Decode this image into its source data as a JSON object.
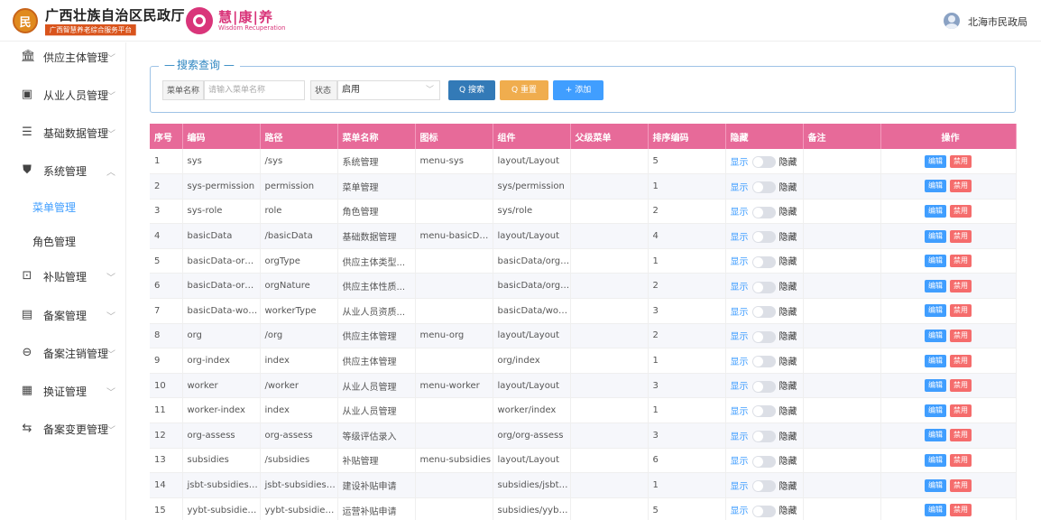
{
  "header": {
    "logo_char": "㎡",
    "org_title": "广西壮族自治区民政厅",
    "org_subtitle": "广西智慧养老综合服务平台",
    "brand_title": "慧|康|养",
    "brand_subtitle": "Wisdom Recuperation",
    "user_name": "北海市民政局"
  },
  "sidebar": {
    "items": [
      {
        "icon": "bank-icon",
        "label": "供应主体管理",
        "chevron": "﹀"
      },
      {
        "icon": "id-card-icon",
        "label": "从业人员管理",
        "chevron": "﹀"
      },
      {
        "icon": "list-icon",
        "label": "基础数据管理",
        "chevron": "﹀"
      },
      {
        "icon": "shield-icon",
        "label": "系统管理",
        "chevron": "︿"
      },
      {
        "icon": "",
        "label": "菜单管理",
        "chevron": ""
      },
      {
        "icon": "",
        "label": "角色管理",
        "chevron": ""
      },
      {
        "icon": "subsidy-icon",
        "label": "补贴管理",
        "chevron": "﹀"
      },
      {
        "icon": "file-icon",
        "label": "备案管理",
        "chevron": "﹀"
      },
      {
        "icon": "cancel-circle-icon",
        "label": "备案注销管理",
        "chevron": "﹀"
      },
      {
        "icon": "card-icon",
        "label": "换证管理",
        "chevron": "﹀"
      },
      {
        "icon": "change-icon",
        "label": "备案变更管理",
        "chevron": "﹀"
      }
    ]
  },
  "search": {
    "legend": "搜索查询",
    "menu_name_label": "菜单名称",
    "menu_name_placeholder": "请输入菜单名称",
    "status_label": "状态",
    "status_value": "启用",
    "search_button": "Q 搜索",
    "reset_button": "Q 重置",
    "add_button": "+ 添加"
  },
  "table": {
    "headers": [
      "序号",
      "编码",
      "路径",
      "菜单名称",
      "图标",
      "组件",
      "父级菜单",
      "排序编码",
      "隐藏",
      "备注",
      "操作"
    ],
    "show_text": "显示",
    "hide_text": "隐藏",
    "edit_text": "编辑",
    "disable_text": "禁用",
    "rows": [
      {
        "no": "1",
        "code": "sys",
        "path": "/sys",
        "name": "系统管理",
        "icon": "menu-sys",
        "component": "layout/Layout",
        "parent": "",
        "sort": "5",
        "remark": ""
      },
      {
        "no": "2",
        "code": "sys-permission",
        "path": "permission",
        "name": "菜单管理",
        "icon": "",
        "component": "sys/permission",
        "parent": "",
        "sort": "1",
        "remark": ""
      },
      {
        "no": "3",
        "code": "sys-role",
        "path": "role",
        "name": "角色管理",
        "icon": "",
        "component": "sys/role",
        "parent": "",
        "sort": "2",
        "remark": ""
      },
      {
        "no": "4",
        "code": "basicData",
        "path": "/basicData",
        "name": "基础数据管理",
        "icon": "menu-basicData",
        "component": "layout/Layout",
        "parent": "",
        "sort": "4",
        "remark": ""
      },
      {
        "no": "5",
        "code": "basicData-orgT...",
        "path": "orgType",
        "name": "供应主体类型...",
        "icon": "",
        "component": "basicData/orgT...",
        "parent": "",
        "sort": "1",
        "remark": ""
      },
      {
        "no": "6",
        "code": "basicData-orgN...",
        "path": "orgNature",
        "name": "供应主体性质...",
        "icon": "",
        "component": "basicData/orgN...",
        "parent": "",
        "sort": "2",
        "remark": ""
      },
      {
        "no": "7",
        "code": "basicData-work...",
        "path": "workerType",
        "name": "从业人员资质...",
        "icon": "",
        "component": "basicData/work...",
        "parent": "",
        "sort": "3",
        "remark": ""
      },
      {
        "no": "8",
        "code": "org",
        "path": "/org",
        "name": "供应主体管理",
        "icon": "menu-org",
        "component": "layout/Layout",
        "parent": "",
        "sort": "2",
        "remark": ""
      },
      {
        "no": "9",
        "code": "org-index",
        "path": "index",
        "name": "供应主体管理",
        "icon": "",
        "component": "org/index",
        "parent": "",
        "sort": "1",
        "remark": ""
      },
      {
        "no": "10",
        "code": "worker",
        "path": "/worker",
        "name": "从业人员管理",
        "icon": "menu-worker",
        "component": "layout/Layout",
        "parent": "",
        "sort": "3",
        "remark": ""
      },
      {
        "no": "11",
        "code": "worker-index",
        "path": "index",
        "name": "从业人员管理",
        "icon": "",
        "component": "worker/index",
        "parent": "",
        "sort": "1",
        "remark": ""
      },
      {
        "no": "12",
        "code": "org-assess",
        "path": "org-assess",
        "name": "等级评估录入",
        "icon": "",
        "component": "org/org-assess",
        "parent": "",
        "sort": "3",
        "remark": ""
      },
      {
        "no": "13",
        "code": "subsidies",
        "path": "/subsidies",
        "name": "补贴管理",
        "icon": "menu-subsidies",
        "component": "layout/Layout",
        "parent": "",
        "sort": "6",
        "remark": ""
      },
      {
        "no": "14",
        "code": "jsbt-subsidies-a...",
        "path": "jsbt-subsidies-...",
        "name": "建设补贴申请",
        "icon": "",
        "component": "subsidies/jsbt-s...",
        "parent": "",
        "sort": "1",
        "remark": ""
      },
      {
        "no": "15",
        "code": "yybt-subsidies-...",
        "path": "yybt-subsidies-...",
        "name": "运营补贴申请",
        "icon": "",
        "component": "subsidies/yybt-...",
        "parent": "",
        "sort": "5",
        "remark": ""
      }
    ]
  }
}
